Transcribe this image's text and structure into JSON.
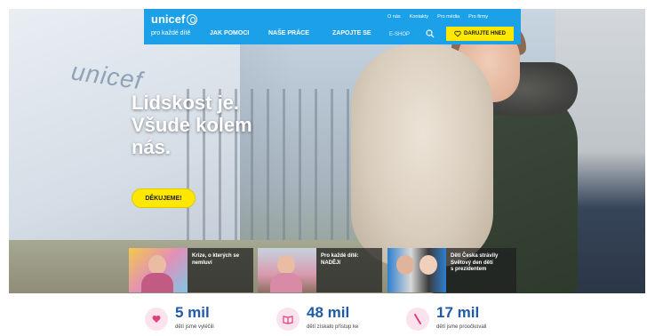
{
  "header": {
    "logo_text": "unicef",
    "tagline": "pro každé dítě",
    "nav": [
      "JAK POMOCI",
      "NAŠE PRÁCE",
      "ZAPOJTE SE"
    ],
    "top_links": [
      "O nás",
      "Kontakty",
      "Pro média",
      "Pro firmy"
    ],
    "eshop": "E-SHOP",
    "donate_label": "DARUJTE HNED"
  },
  "hero": {
    "tent_logo": "unicef",
    "headline_1": "Lidskost je.",
    "headline_2": "Všude kolem",
    "headline_3": "nás.",
    "cta_label": "DĚKUJEME!"
  },
  "tiles": [
    {
      "line1": "Krize, o kterých se",
      "line2": "nemluví",
      "line3": ""
    },
    {
      "line1": "Pro každé dítě:",
      "line2": "NADĚJI",
      "line3": ""
    },
    {
      "line1": "Děti Česka strávily",
      "line2": "Světový den dětí",
      "line3": "s prezidentem"
    }
  ],
  "stats": [
    {
      "value": "5 mil",
      "label": "dětí jsme vyléčili"
    },
    {
      "value": "48 mil",
      "label": "dětí získalo přístup ke"
    },
    {
      "value": "17 mil",
      "label": "dětí jsme proočkovali"
    }
  ],
  "colors": {
    "brand_blue": "#1ca0e8",
    "donate_yellow": "#ffe800",
    "stat_blue": "#1f5aa8",
    "stat_icon_bg": "#fbe3ee"
  }
}
